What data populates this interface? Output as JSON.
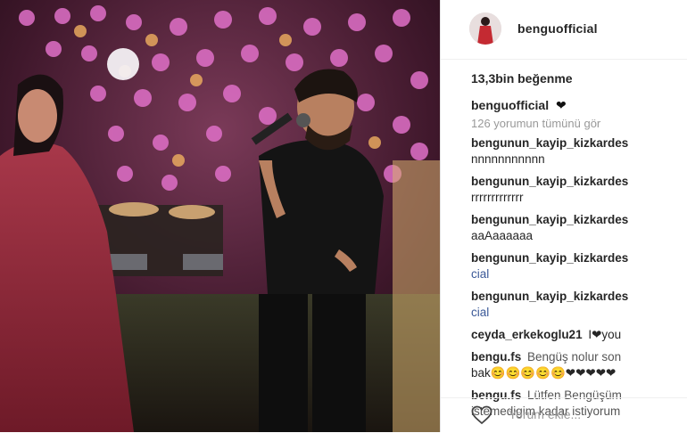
{
  "post": {
    "username": "benguofficial",
    "likes": "13,3bin beğenme",
    "caption_user": "benguofficial",
    "caption_text": "❤",
    "view_all": "126 yorumun tümünü gör"
  },
  "comments": [
    {
      "user": "bengunun_kayip_kizkardes",
      "text": "nnnnnnnnnnn"
    },
    {
      "user": "bengunun_kayip_kizkardes",
      "text": "rrrrrrrrrrrrr"
    },
    {
      "user": "bengunun_kayip_kizkardes",
      "text": "aaAaaaaaa"
    },
    {
      "user": "bengunun_kayip_kizkardes",
      "text": "cial"
    },
    {
      "user": "bengunun_kayip_kizkardes",
      "text": "cial"
    },
    {
      "user": "ceyda_erkekoglu21",
      "text": "I❤you"
    },
    {
      "user": "bengu.fs",
      "text": "Bengüş nolur son",
      "text2": "bak😊😊😊😊😊❤❤❤❤❤"
    },
    {
      "user": "bengu.fs",
      "text": "Lütfen Bengüşüm",
      "text2": "istemedigim kadar istiyorum"
    }
  ],
  "footer": {
    "input_placeholder": "Yorum ekle..."
  },
  "colors": {
    "link": "#3b5998",
    "text": "#262626",
    "muted": "#999999"
  },
  "icons": {
    "like": "heart-outline-icon"
  }
}
